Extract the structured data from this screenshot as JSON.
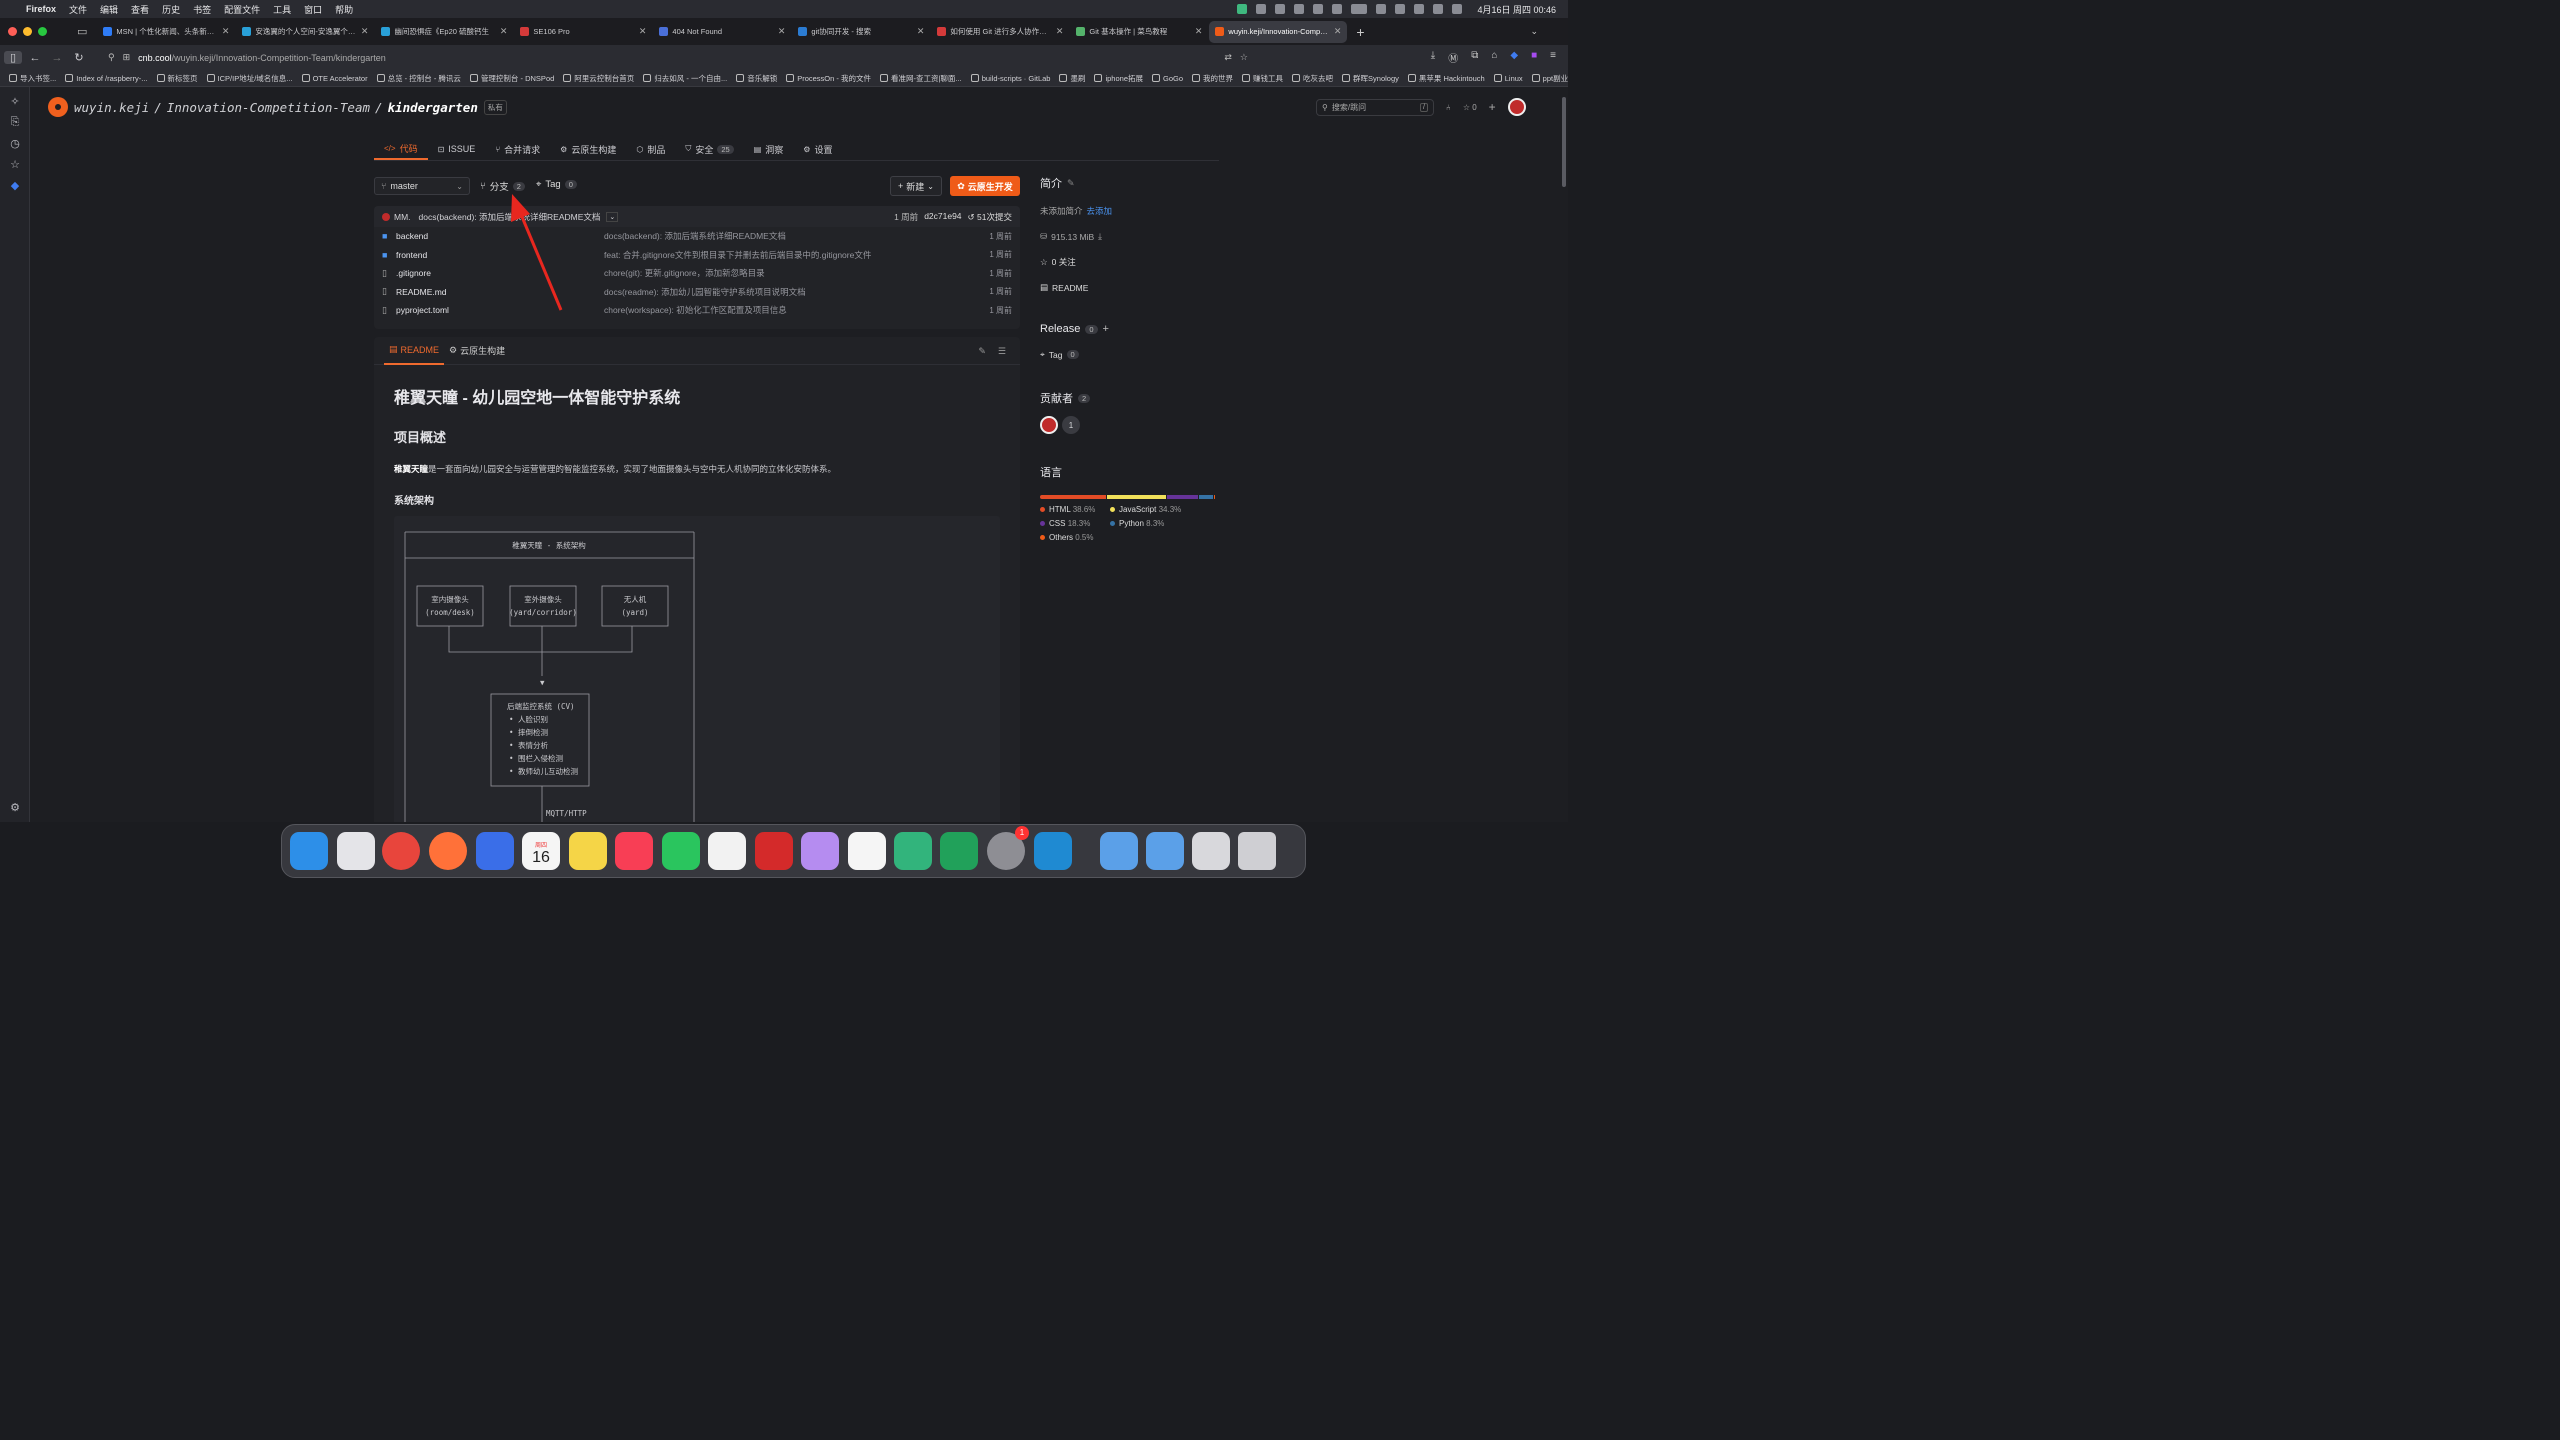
{
  "menubar": {
    "app": "Firefox",
    "items": [
      "文件",
      "编辑",
      "查看",
      "历史",
      "书签",
      "配置文件",
      "工具",
      "窗口",
      "帮助"
    ],
    "clock": "4月16日 周四 00:46"
  },
  "browser_tabs": [
    {
      "title": "MSN | 个性化新闻、头条新闻、实",
      "color": "#2f7cf6"
    },
    {
      "title": "安逸翼的个人空间-安逸翼个人主页",
      "color": "#29a0d8"
    },
    {
      "title": "幽间恐惧症《Ep20 硫酸钙生",
      "color": "#29a0d8"
    },
    {
      "title": "SE106 Pro",
      "color": "#d43a3a"
    },
    {
      "title": "404 Not Found",
      "color": "#4a6fd8"
    },
    {
      "title": "git协同开发 - 搜索",
      "color": "#2b7cd3"
    },
    {
      "title": "如何使用 Git 进行多人协作开发（",
      "color": "#d43a3a"
    },
    {
      "title": "Git 基本操作 | 菜鸟教程",
      "color": "#54b36b"
    },
    {
      "title": "wuyin.keji/Innovation-Competiti",
      "color": "#ef5b18"
    }
  ],
  "url": {
    "prefix": "cnb.cool",
    "path": "/wuyin.keji/Innovation-Competition-Team/kindergarten"
  },
  "bookmarks": [
    "导入书签...",
    "Index of /raspberry-...",
    "新标签页",
    "ICP/IP地址/域名信息...",
    "OTE Accelerator",
    "总览 - 控制台 - 腾讯云",
    "管理控制台 - DNSPod",
    "阿里云控制台首页",
    "归去如风 - 一个自由...",
    "音乐解锁",
    "ProcessOn - 我的文件",
    "看准网-查工资|聊面...",
    "build-scripts · GitLab",
    "墨刷",
    "iphone拓展",
    "GoGo",
    "我的世界",
    "赚钱工具",
    "吃灰去吧",
    "群晖Synology",
    "黑苹果 Hackintouch",
    "Linux",
    "ppt副业营"
  ],
  "repo": {
    "owner": "wuyin.keji",
    "group": "Innovation-Competition-Team",
    "name": "kindergarten",
    "visibility": "私有",
    "search_placeholder": "搜索/跳问",
    "search_key": "/",
    "stars": "0"
  },
  "repo_tabs": [
    {
      "label": "代码",
      "icon": "</>",
      "active": true
    },
    {
      "label": "ISSUE",
      "icon": "⊡"
    },
    {
      "label": "合并请求",
      "icon": "⑂"
    },
    {
      "label": "云原生构建",
      "icon": "⚙"
    },
    {
      "label": "制品",
      "icon": "⬡"
    },
    {
      "label": "安全",
      "icon": "⛉",
      "count": "25"
    },
    {
      "label": "洞察",
      "icon": "▤"
    },
    {
      "label": "设置",
      "icon": "⚙"
    }
  ],
  "toolbar": {
    "branch": "master",
    "branches_label": "分支",
    "branches_count": "2",
    "tag_label": "Tag",
    "tag_count": "0",
    "new_label": "新建",
    "cloud_label": "云原生开发"
  },
  "commit": {
    "author": "MM.",
    "message": "docs(backend): 添加后端系统详细README文档",
    "time": "1 周前",
    "hash": "d2c71e94",
    "count": "51次提交"
  },
  "files": [
    {
      "name": "backend",
      "type": "dir",
      "msg": "docs(backend): 添加后端系统详细README文档",
      "time": "1 周前"
    },
    {
      "name": "frontend",
      "type": "dir",
      "msg": "feat: 合并.gitignore文件到根目录下并删去前后端目录中的.gitignore文件",
      "time": "1 周前"
    },
    {
      "name": ".gitignore",
      "type": "file",
      "msg": "chore(git): 更新.gitignore，添加新忽略目录",
      "time": "1 周前"
    },
    {
      "name": "README.md",
      "type": "file",
      "msg": "docs(readme): 添加幼儿园智能守护系统项目说明文档",
      "time": "1 周前"
    },
    {
      "name": "pyproject.toml",
      "type": "file",
      "msg": "chore(workspace): 初始化工作区配置及项目信息",
      "time": "1 周前"
    }
  ],
  "readme": {
    "tab_readme": "README",
    "tab_build": "云原生构建",
    "title": "稚翼天瞳 - 幼儿园空地一体智能守护系统",
    "overview_heading": "项目概述",
    "overview_bold": "稚翼天瞳",
    "overview_text": "是一套面向幼儿园安全与运营管理的智能监控系统，实现了地面摄像头与空中无人机协同的立体化安防体系。",
    "arch_heading": "系统架构",
    "diagram": {
      "title": "稚翼天瞳 - 系统架构",
      "cam1": [
        "室内摄像头",
        "(room/desk)"
      ],
      "cam2": [
        "室外摄像头",
        "(yard/corridor)"
      ],
      "cam3": [
        "无人机",
        "(yard)"
      ],
      "backend": [
        "后端监控系统 (CV)",
        "• 人脸识别",
        "• 摔倒检测",
        "• 表情分析",
        "• 围栏入侵检测",
        "• 教师幼儿互动检测"
      ],
      "proto": "MQTT/HTTP"
    }
  },
  "about": {
    "title": "简介",
    "empty": "未添加简介",
    "add": "去添加",
    "size": "915.13 MiB",
    "watchers": "0 关注",
    "readme": "README",
    "release_label": "Release",
    "release_count": "0",
    "tag_label": "Tag",
    "tag_count": "0",
    "contributors_label": "贡献者",
    "contributors_count": "2",
    "contributor_more": "1",
    "languages_label": "语言"
  },
  "languages": [
    {
      "name": "HTML",
      "pct": "38.6%",
      "value": 38.6,
      "color": "#e34c26"
    },
    {
      "name": "JavaScript",
      "pct": "34.3%",
      "value": 34.3,
      "color": "#f1e05a"
    },
    {
      "name": "CSS",
      "pct": "18.3%",
      "value": 18.3,
      "color": "#663399"
    },
    {
      "name": "Python",
      "pct": "8.3%",
      "value": 8.3,
      "color": "#3572a5"
    },
    {
      "name": "Others",
      "pct": "0.5%",
      "value": 0.5,
      "color": "#ef5b18"
    }
  ],
  "dock": {
    "calendar_day": "16",
    "calendar_weekday": "周四",
    "badge": "1"
  }
}
